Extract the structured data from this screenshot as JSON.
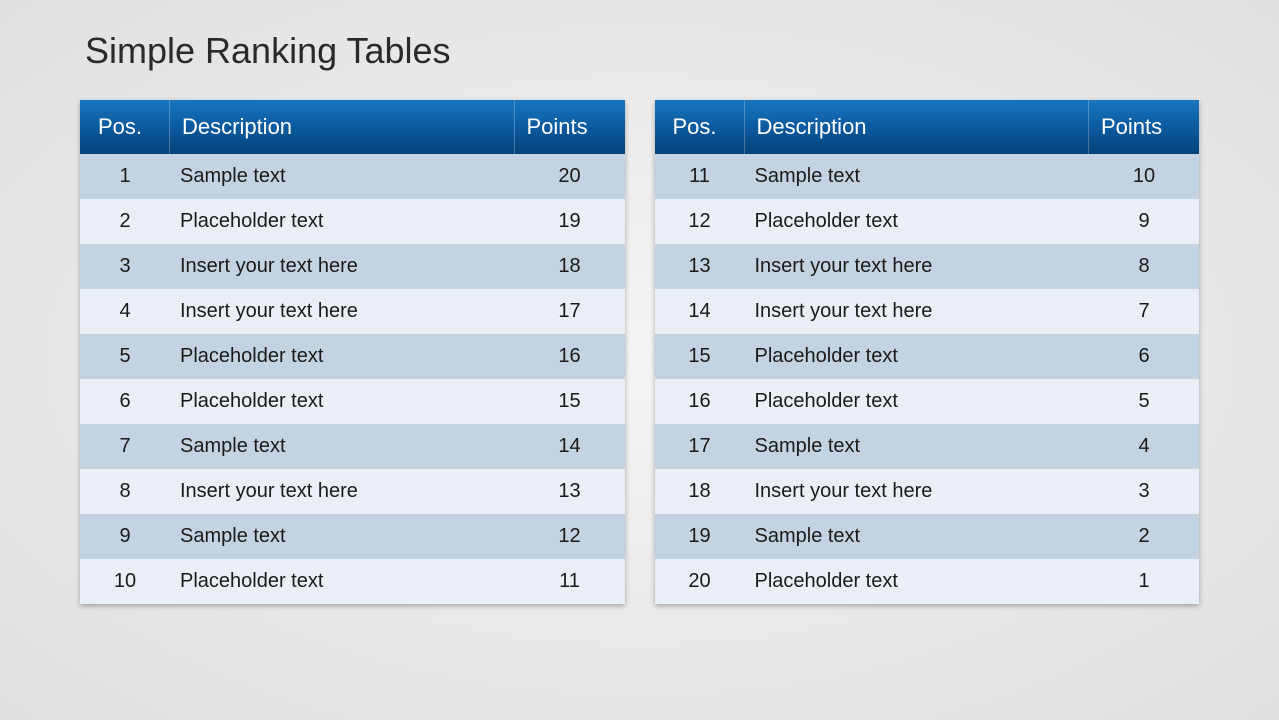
{
  "title": "Simple Ranking Tables",
  "headers": {
    "pos": "Pos.",
    "desc": "Description",
    "points": "Points"
  },
  "tables": [
    {
      "rows": [
        {
          "pos": "1",
          "desc": "Sample text",
          "points": "20"
        },
        {
          "pos": "2",
          "desc": "Placeholder text",
          "points": "19"
        },
        {
          "pos": "3",
          "desc": "Insert your text here",
          "points": "18"
        },
        {
          "pos": "4",
          "desc": "Insert your text here",
          "points": "17"
        },
        {
          "pos": "5",
          "desc": "Placeholder text",
          "points": "16"
        },
        {
          "pos": "6",
          "desc": "Placeholder text",
          "points": "15"
        },
        {
          "pos": "7",
          "desc": "Sample text",
          "points": "14"
        },
        {
          "pos": "8",
          "desc": "Insert your text here",
          "points": "13"
        },
        {
          "pos": "9",
          "desc": "Sample text",
          "points": "12"
        },
        {
          "pos": "10",
          "desc": "Placeholder text",
          "points": "11"
        }
      ]
    },
    {
      "rows": [
        {
          "pos": "11",
          "desc": "Sample text",
          "points": "10"
        },
        {
          "pos": "12",
          "desc": "Placeholder text",
          "points": "9"
        },
        {
          "pos": "13",
          "desc": "Insert your text here",
          "points": "8"
        },
        {
          "pos": "14",
          "desc": "Insert your text here",
          "points": "7"
        },
        {
          "pos": "15",
          "desc": "Placeholder text",
          "points": "6"
        },
        {
          "pos": "16",
          "desc": "Placeholder text",
          "points": "5"
        },
        {
          "pos": "17",
          "desc": "Sample text",
          "points": "4"
        },
        {
          "pos": "18",
          "desc": "Insert your text here",
          "points": "3"
        },
        {
          "pos": "19",
          "desc": "Sample text",
          "points": "2"
        },
        {
          "pos": "20",
          "desc": "Placeholder text",
          "points": "1"
        }
      ]
    }
  ]
}
